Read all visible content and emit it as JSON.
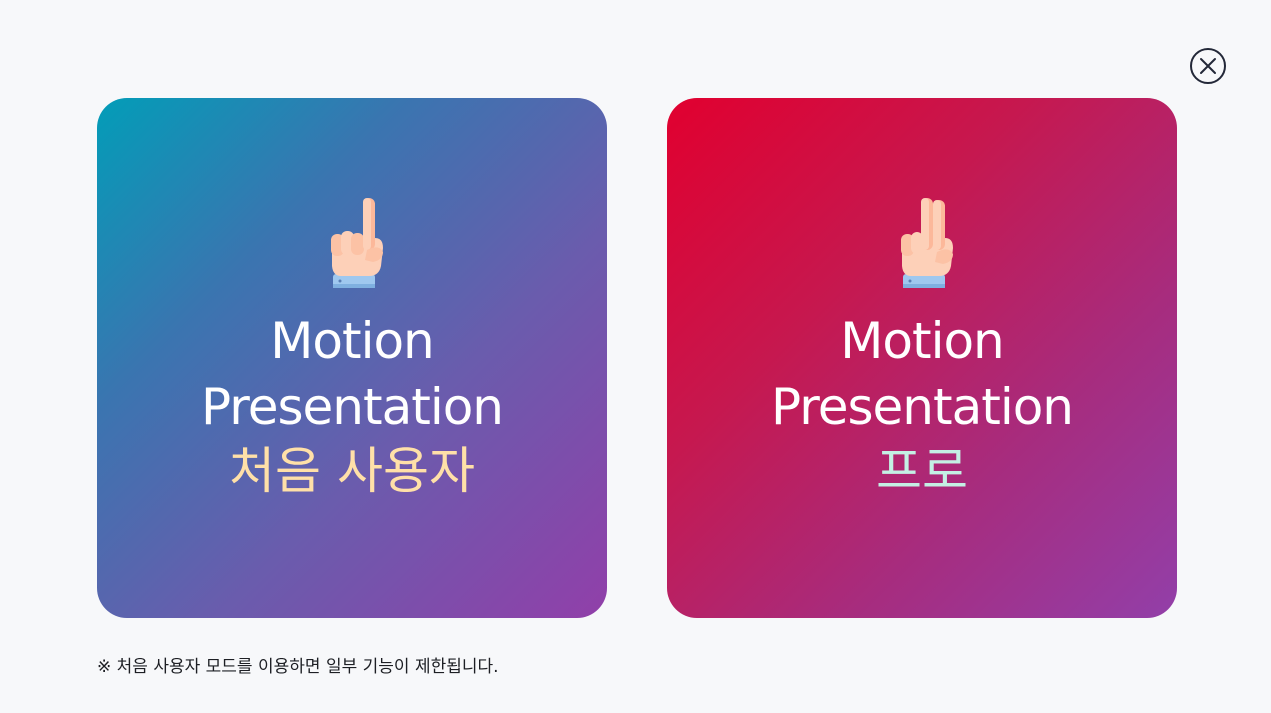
{
  "close": {
    "icon": "close-circle-icon"
  },
  "cards": [
    {
      "icon": "index-finger-up-icon",
      "title_line1": "Motion",
      "title_line2": "Presentation",
      "subtitle": "처음 사용자",
      "subtitle_color": "#ffe0a8"
    },
    {
      "icon": "two-fingers-up-icon",
      "title_line1": "Motion",
      "title_line2": "Presentation",
      "subtitle": "프로",
      "subtitle_color": "#c4f0e4"
    }
  ],
  "notice": "※ 처음 사용자 모드를 이용하면 일부 기능이 제한됩니다.",
  "colors": {
    "background": "#f7f8fa",
    "card_beginner_gradient": [
      "#029db8",
      "#913fa9"
    ],
    "card_pro_gradient": [
      "#e1002f",
      "#923fa9"
    ]
  }
}
